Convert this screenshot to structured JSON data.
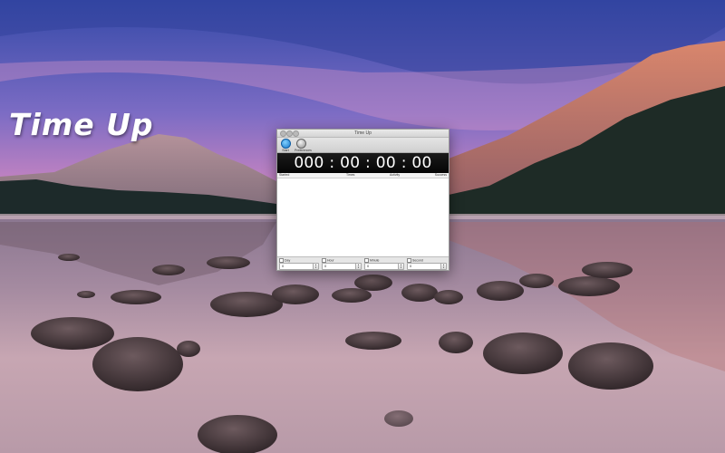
{
  "promo": {
    "title": "Time Up"
  },
  "window": {
    "title": "Time Up",
    "toolbar": {
      "start_label": "Start",
      "preferences_label": "Preferences"
    },
    "timer": "000 : 00 : 00 : 00",
    "list_columns": {
      "started": "Started",
      "times": "Times",
      "activity": "Activity",
      "success": "Success"
    },
    "fields": {
      "day": {
        "label": "Day",
        "value": "0"
      },
      "hour": {
        "label": "Hour",
        "value": "0"
      },
      "minute": {
        "label": "Minute",
        "value": "0"
      },
      "second": {
        "label": "Second",
        "value": "0"
      }
    }
  },
  "colors": {
    "sky_top": "#3a55b0",
    "sky_pink": "#e08ab8",
    "lake": "#6e5a78",
    "accent_blue": "#1877c9"
  }
}
